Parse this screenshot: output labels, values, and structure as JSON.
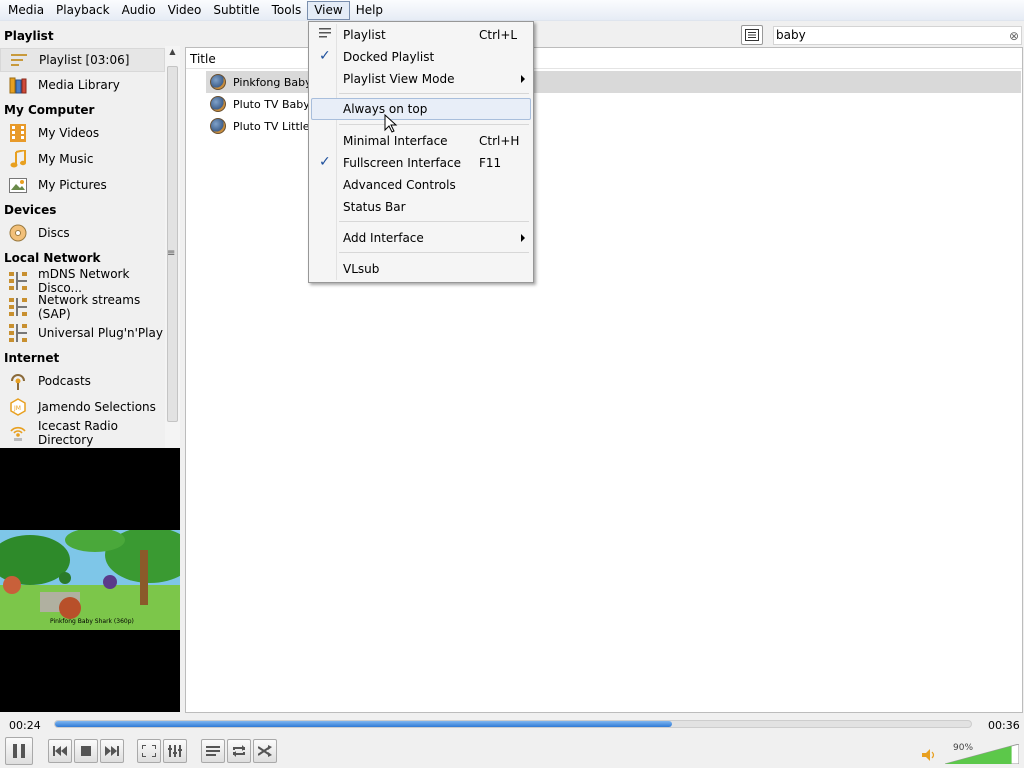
{
  "menubar": [
    "Media",
    "Playback",
    "Audio",
    "Video",
    "Subtitle",
    "Tools",
    "View",
    "Help"
  ],
  "sidebar": {
    "sections": {
      "playlist": "Playlist",
      "my_computer": "My Computer",
      "devices": "Devices",
      "local_network": "Local Network",
      "internet": "Internet"
    },
    "items": [
      {
        "label": "Playlist [03:06]",
        "icon": "playlist-icon"
      },
      {
        "label": "Media Library",
        "icon": "media-library-icon"
      },
      {
        "label": "My Videos",
        "icon": "film-icon"
      },
      {
        "label": "My Music",
        "icon": "music-note-icon"
      },
      {
        "label": "My Pictures",
        "icon": "picture-icon"
      },
      {
        "label": "Discs",
        "icon": "disc-icon"
      },
      {
        "label": "mDNS Network Disco...",
        "icon": "network-icon"
      },
      {
        "label": "Network streams (SAP)",
        "icon": "network-icon"
      },
      {
        "label": "Universal Plug'n'Play",
        "icon": "network-icon"
      },
      {
        "label": "Podcasts",
        "icon": "podcast-icon"
      },
      {
        "label": "Jamendo Selections",
        "icon": "jamendo-icon"
      },
      {
        "label": "Icecast Radio Directory",
        "icon": "radio-icon"
      }
    ]
  },
  "video": {
    "caption": "Pinkfong Baby Shark (360p)"
  },
  "playlist": {
    "column_title": "Title",
    "rows": [
      "Pinkfong Baby S",
      "Pluto TV BabyF",
      "Pluto TV Little B"
    ]
  },
  "search": {
    "value": "baby",
    "clear": "⊗"
  },
  "view_menu": {
    "items": [
      {
        "label": "Playlist",
        "shortcut": "Ctrl+L",
        "checked": false,
        "icon": "playlist-icon"
      },
      {
        "label": "Docked Playlist",
        "shortcut": "",
        "checked": true
      },
      {
        "label": "Playlist View Mode",
        "shortcut": "",
        "submenu": true
      },
      {
        "label": "Always on top",
        "shortcut": "",
        "highlighted": true
      },
      {
        "label": "Minimal Interface",
        "shortcut": "Ctrl+H"
      },
      {
        "label": "Fullscreen Interface",
        "shortcut": "F11",
        "checked": true
      },
      {
        "label": "Advanced Controls",
        "shortcut": ""
      },
      {
        "label": "Status Bar",
        "shortcut": ""
      },
      {
        "label": "Add Interface",
        "shortcut": "",
        "submenu": true
      },
      {
        "label": "VLsub",
        "shortcut": ""
      }
    ]
  },
  "controls": {
    "elapsed": "00:24",
    "total": "00:36",
    "progress": 0.674,
    "volume_label": "90%",
    "volume": 0.9
  },
  "colors": {
    "accent": "#2f7ad6",
    "check": "#1d4f9c",
    "menu_hover": "#e8eef8"
  }
}
